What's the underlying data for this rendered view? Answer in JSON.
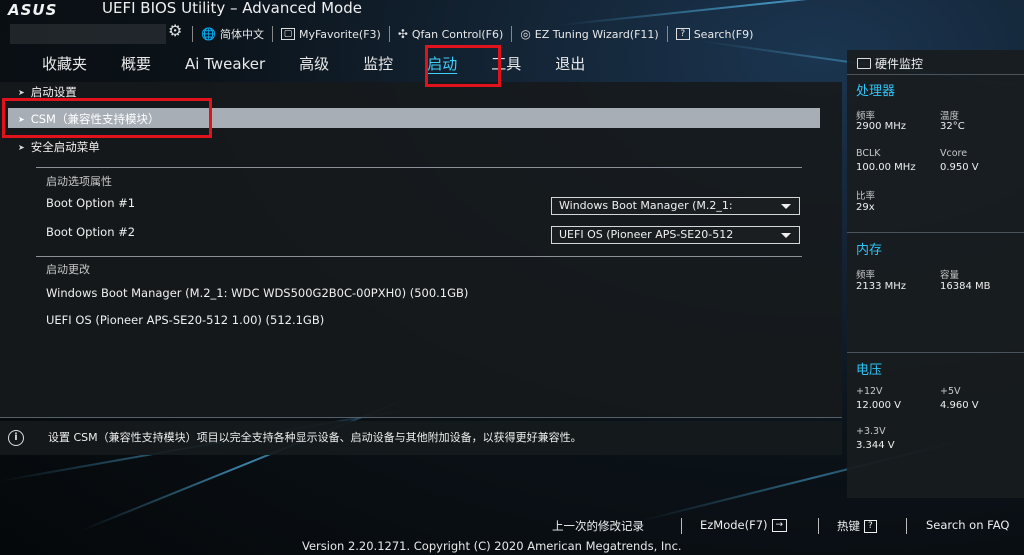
{
  "header": {
    "logo": "ASUS",
    "title": "UEFI BIOS Utility – Advanced Mode",
    "toolbar": [
      {
        "label": "简体中文",
        "icon": "globe-icon"
      },
      {
        "label": "MyFavorite(F3)",
        "icon": "favorite-icon"
      },
      {
        "label": "Qfan Control(F6)",
        "icon": "fan-icon"
      },
      {
        "label": "EZ Tuning Wizard(F11)",
        "icon": "bulb-icon"
      },
      {
        "label": "Search(F9)",
        "icon": "search-icon"
      }
    ]
  },
  "tabs": [
    "收藏夹",
    "概要",
    "Ai Tweaker",
    "高级",
    "监控",
    "启动",
    "工具",
    "退出"
  ],
  "active_tab": "启动",
  "main": {
    "items": {
      "boot_settings": "启动设置",
      "csm": "CSM（兼容性支持模块）",
      "secure_boot": "安全启动菜单"
    },
    "boot_option_priorities": "启动选项属性",
    "boot_options": [
      {
        "label": "Boot Option #1",
        "value": "Windows Boot Manager (M.2_1:"
      },
      {
        "label": "Boot Option #2",
        "value": "UEFI OS (Pioneer APS-SE20-512"
      }
    ],
    "boot_override": "启动更改",
    "override_devices": [
      "Windows Boot Manager (M.2_1: WDC WDS500G2B0C-00PXH0) (500.1GB)",
      "UEFI OS (Pioneer APS-SE20-512 1.00) (512.1GB)"
    ]
  },
  "help": {
    "icon": "info-icon",
    "text": "设置 CSM（兼容性支持模块）项目以完全支持各种显示设备、启动设备与其他附加设备，以获得更好兼容性。"
  },
  "monitor": {
    "title": "硬件监控",
    "cpu": {
      "title": "处理器",
      "freq_label": "频率",
      "freq": "2900 MHz",
      "temp_label": "温度",
      "temp": "32°C",
      "bclk_label": "BCLK",
      "bclk": "100.00 MHz",
      "vcore_label": "Vcore",
      "vcore": "0.950 V",
      "ratio_label": "比率",
      "ratio": "29x"
    },
    "memory": {
      "title": "内存",
      "freq_label": "频率",
      "freq": "2133 MHz",
      "cap_label": "容量",
      "cap": "16384 MB"
    },
    "voltage": {
      "title": "电压",
      "v12_label": "+12V",
      "v12": "12.000 V",
      "v5_label": "+5V",
      "v5": "4.960 V",
      "v33_label": "+3.3V",
      "v33": "3.344 V"
    }
  },
  "footer": {
    "last_modified": "上一次的修改记录",
    "ezmode": "EzMode(F7)",
    "hotkeys": "热键",
    "hotkeys_key": "?",
    "search_faq": "Search on FAQ",
    "version": "Version 2.20.1271. Copyright (C) 2020 American Megatrends, Inc."
  },
  "colors": {
    "accent": "#2fc4f5",
    "highlight": "#e0121c",
    "selection": "#a7aeb6"
  }
}
